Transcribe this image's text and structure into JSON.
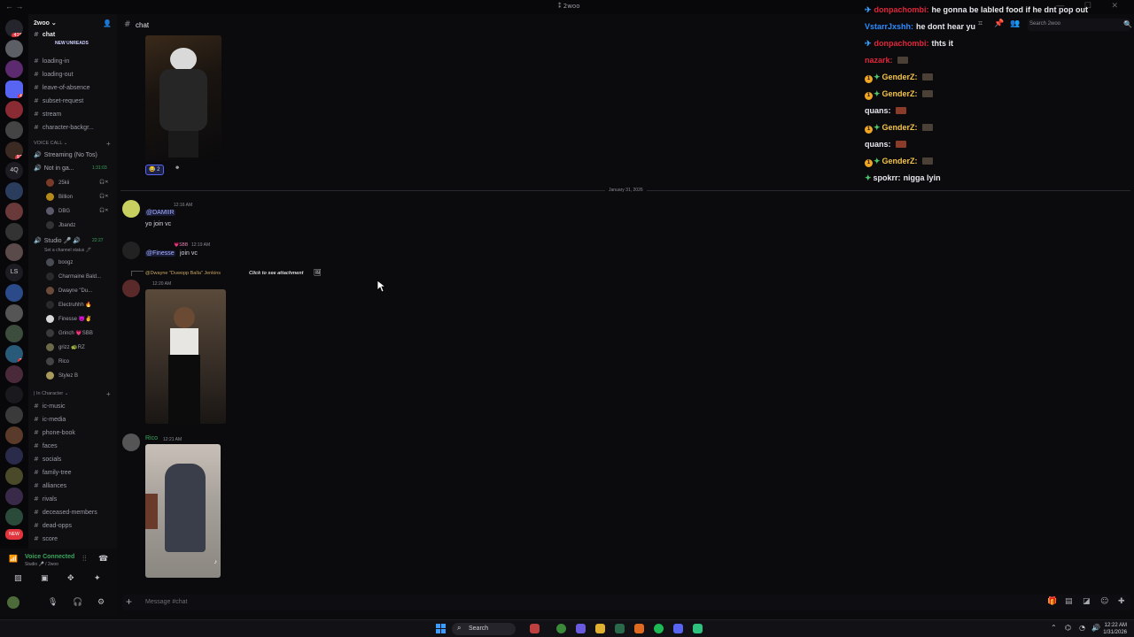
{
  "window": {
    "title": "2woo",
    "back": "←",
    "forward": "→",
    "controls": "— ☐ ✕"
  },
  "server": {
    "name": "2woo ⌄",
    "new_unreads": "NEW UNREADS",
    "top_channel": "chat"
  },
  "rail": {
    "badges": [
      "418",
      "",
      "",
      "4",
      "",
      "",
      "",
      "",
      "97",
      "",
      "4Q",
      "",
      "",
      "",
      "",
      "",
      "LS",
      "",
      "",
      "",
      "",
      "3",
      "",
      "",
      "",
      "",
      "",
      "",
      "",
      "",
      "NEW"
    ],
    "labels": {
      "q": "4Q",
      "ls": "LS"
    }
  },
  "sidebar": {
    "text_channels_top": [
      "loading-in",
      "loading-out",
      "leave-of-absence",
      "subset-request",
      "stream",
      "character-backgr..."
    ],
    "voice_category": "VOICE CALL",
    "voice_channels": [
      {
        "name": "Streaming (No Tos)",
        "timer": ""
      },
      {
        "name": "Not in ga...",
        "timer": "1:31:03"
      }
    ],
    "voice_users_1": [
      "25kii",
      "Billion",
      "DBG",
      "Jbandz"
    ],
    "studio": {
      "name": "Studio 🎤 🔊",
      "timer": "22:27",
      "status": "Set a channel status 🖊"
    },
    "voice_users_2": [
      "boogz",
      "Charmaine Bald...",
      "Dwayne \"Du...",
      "Electruhhh 🔥",
      "Finesse 😈​✌",
      "Grinch 💗SBB",
      "grizz 🐢RZ",
      "Rico",
      "Stylez B"
    ],
    "in_character_category": "| In Character",
    "text_channels_bottom": [
      "ic-music",
      "ic-media",
      "phone-book",
      "faces",
      "socials",
      "family-tree",
      "alliances",
      "rivals",
      "deceased-members",
      "dead-opps",
      "score"
    ]
  },
  "user_panel": {
    "voice_status": "Voice Connected",
    "voice_sub": "Studio 🎤 / 2woo"
  },
  "header": {
    "channel": "chat",
    "search_placeholder": "Search 2woo"
  },
  "messages": {
    "reaction_count": "2",
    "date_divider": "January 31, 2026",
    "m1": {
      "time": "12:16 AM",
      "mention": "@DAMIIR",
      "text": "yo join vc"
    },
    "m2": {
      "time": "12:19 AM",
      "badge": "💗SBB",
      "mention": "@Finesse",
      "text": "join vc"
    },
    "m3": {
      "reply_to": "@Dwayne \"Duwopp Balla\" Jenkins",
      "reply_text": "Click to see attachment",
      "time": "12:20 AM"
    },
    "m4": {
      "author": "Rico",
      "time": "12:21 AM"
    }
  },
  "overlay": [
    {
      "badge": "pin",
      "user": "donpachombi:",
      "user_color": "#e0273a",
      "text": "he gonna be labled food if he dnt pop out",
      "emote": ""
    },
    {
      "badge": "",
      "user": "VstarrJxshh:",
      "user_color": "#2b8cff",
      "text": "he dont hear yu",
      "emote": ""
    },
    {
      "badge": "pin",
      "user": "donpachombi:",
      "user_color": "#e0273a",
      "text": "thts it",
      "emote": ""
    },
    {
      "badge": "",
      "user": "nazark:",
      "user_color": "#e0273a",
      "text": "",
      "emote": "brown"
    },
    {
      "badge": "gift",
      "user": "GenderZ:",
      "user_color": "#f4c44a",
      "text": "",
      "emote": "brown"
    },
    {
      "badge": "gift",
      "user": "GenderZ:",
      "user_color": "#f4c44a",
      "text": "",
      "emote": "brown"
    },
    {
      "badge": "",
      "user": "quans:",
      "user_color": "#e8e8ec",
      "text": "",
      "emote": "red"
    },
    {
      "badge": "gift",
      "user": "GenderZ:",
      "user_color": "#f4c44a",
      "text": "",
      "emote": "brown"
    },
    {
      "badge": "",
      "user": "quans:",
      "user_color": "#e8e8ec",
      "text": "",
      "emote": "red"
    },
    {
      "badge": "gift",
      "user": "GenderZ:",
      "user_color": "#f4c44a",
      "text": "",
      "emote": "brown"
    },
    {
      "badge": "spark",
      "user": "spokrr:",
      "user_color": "#e8e8ec",
      "text": "nigga lyin",
      "emote": ""
    }
  ],
  "composer": {
    "placeholder": "Message #chat"
  },
  "taskbar": {
    "search": "Search",
    "time": "12:22 AM",
    "date": "1/31/2026"
  },
  "colors": {
    "accent": "#5865f2",
    "online": "#3ba55c",
    "mention_bg": "#5865f2",
    "badge_red": "#e2343c"
  }
}
